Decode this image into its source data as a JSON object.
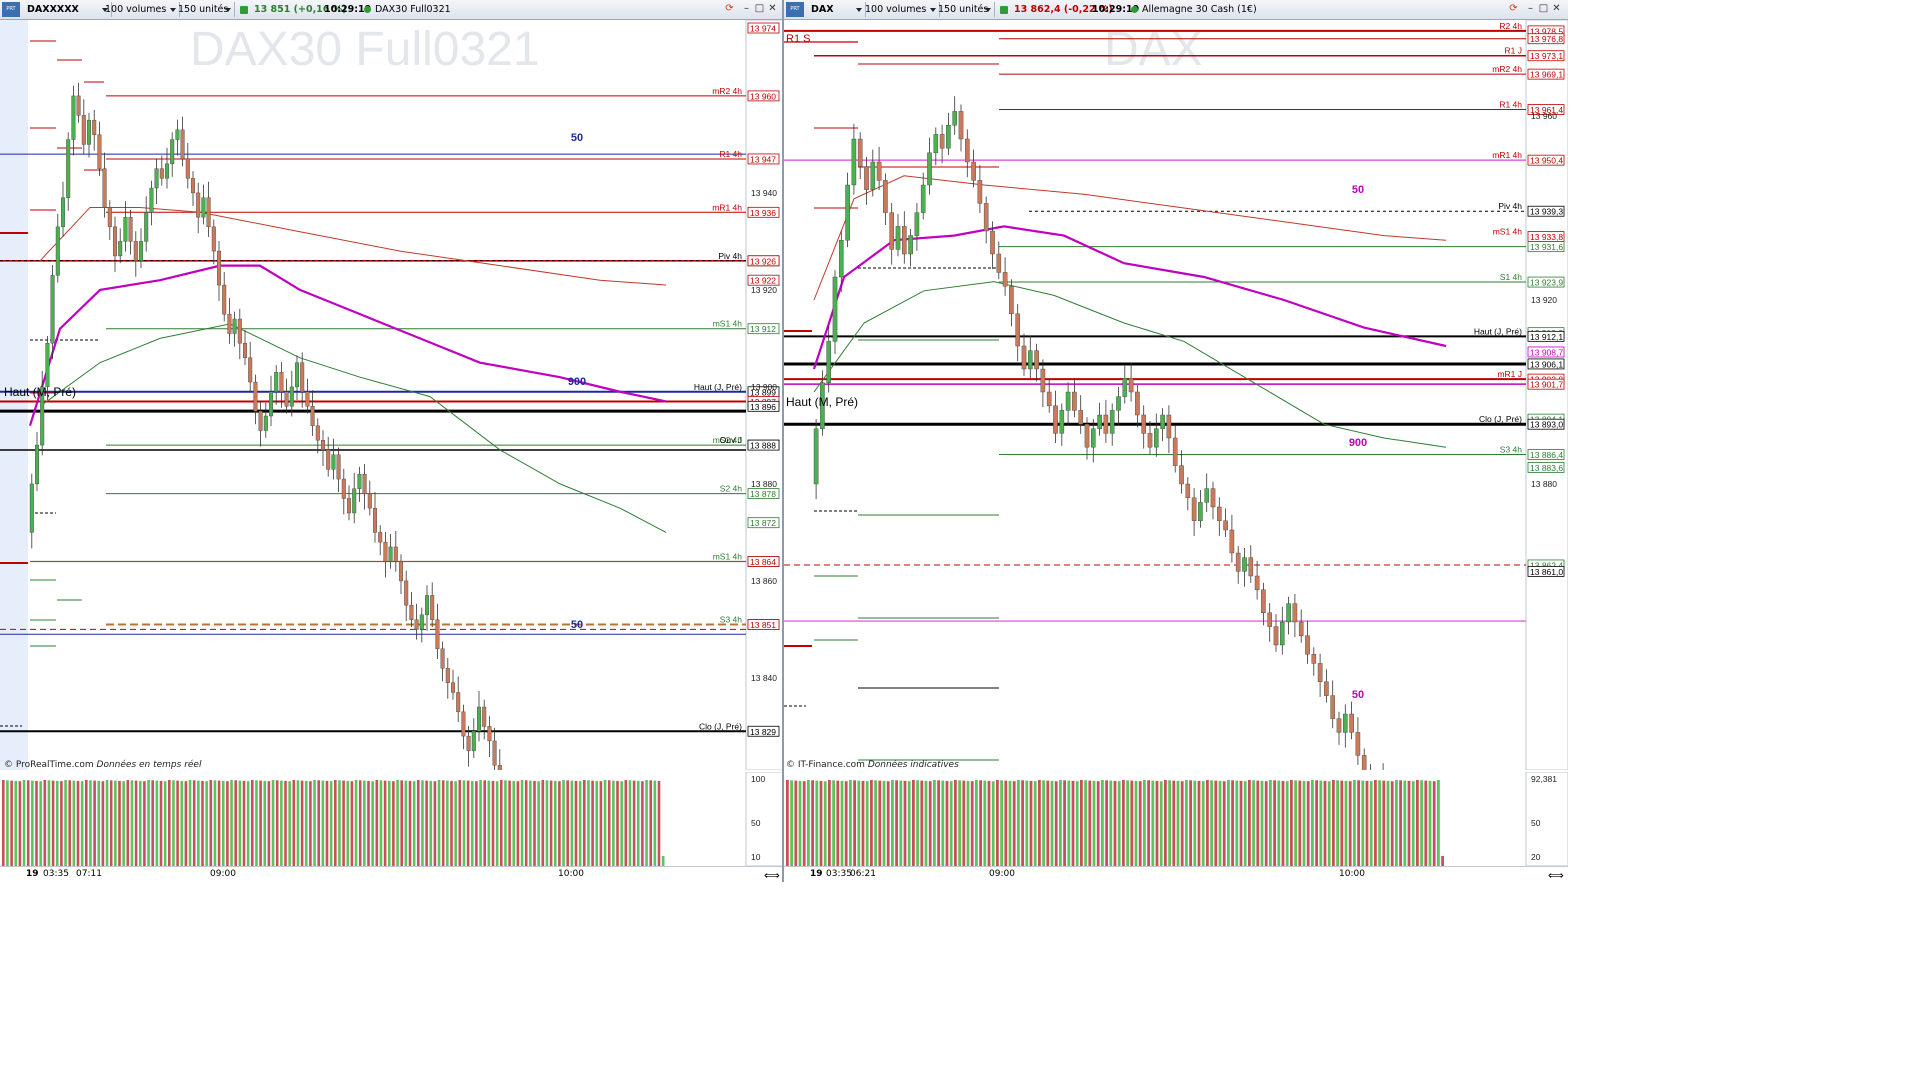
{
  "left": {
    "toolbar": {
      "instrument": "DAXXXXX",
      "volume_mode": "100 volumes",
      "units": "150 unités",
      "price": "13 851 (+0,16 %)",
      "time": "10:29:19",
      "market_name": "DAX30 Full0321"
    },
    "watermark": "DAX30 Full0321",
    "credit_source": "© ProRealTime.com",
    "credit_note": "Données en temps réel",
    "price_axis": [
      "13 940",
      "13 920",
      "13 900",
      "13 880",
      "13 860",
      "13 840"
    ],
    "level_boxes": [
      {
        "label": "",
        "value": "13 974",
        "color": "#c00000"
      },
      {
        "label": "mR2 4h",
        "value": "13 960",
        "color": "#c00000"
      },
      {
        "label": "R1 4h",
        "value": "13 947",
        "color": "#c00000"
      },
      {
        "label": "mR1 4h",
        "value": "13 936",
        "color": "#c00000"
      },
      {
        "label": "Piv 4h",
        "value": "13 926",
        "color": "#000000"
      },
      {
        "label": "",
        "value": "13 926",
        "color": "#c00000"
      },
      {
        "label": "",
        "value": "13 922",
        "color": "#c00000"
      },
      {
        "label": "mS1 4h",
        "value": "13 912",
        "color": "#2e7d32"
      },
      {
        "label": "Haut (J, Pré)",
        "value": "13 899",
        "color": "#000000"
      },
      {
        "label": "",
        "value": "13 897",
        "color": "#c00000"
      },
      {
        "label": "",
        "value": "13 896",
        "color": "#000000"
      },
      {
        "label": "mS2 4h",
        "value": "13 888",
        "color": "#2e7d32"
      },
      {
        "label": "Ouv J",
        "value": "13 888",
        "color": "#000000"
      },
      {
        "label": "S2 4h",
        "value": "13 878",
        "color": "#2e7d32"
      },
      {
        "label": "",
        "value": "13 872",
        "color": "#2e7d32"
      },
      {
        "label": "mS1 4h",
        "value": "13 864",
        "color": "#2e7d32"
      },
      {
        "label": "",
        "value": "13 864",
        "color": "#c00000"
      },
      {
        "label": "S3 4h",
        "value": "13 851",
        "color": "#2e7d32"
      },
      {
        "label": "",
        "value": "13 851",
        "color": "#c00000"
      },
      {
        "label": "Clo (J, Pré)",
        "value": "13 829",
        "color": "#000000"
      }
    ],
    "marks": {
      "fifty": "50",
      "nine_hundred": "900",
      "haut_m_pre": "Haut (M, Pré)"
    },
    "volume_axis": [
      "100",
      "50",
      "10"
    ],
    "time_labels": [
      "19",
      "03:35",
      "07:11",
      "09:00",
      "10:00"
    ]
  },
  "right": {
    "toolbar": {
      "instrument": "DAX",
      "volume_mode": "100 volumes",
      "units": "150 unités",
      "price": "13 862,4 (-0,22 %)",
      "time": "10:29:19",
      "market_name": "Allemagne 30 Cash (1€)"
    },
    "watermark": "DAX",
    "credit_source": "© IT-Finance.com",
    "credit_note": "Données indicatives",
    "price_axis": [
      "13 960",
      "13 920",
      "13 880"
    ],
    "level_boxes": [
      {
        "label": "R2 4h",
        "value": "13 978,5",
        "color": "#c00000"
      },
      {
        "label": "",
        "value": "13 976,8",
        "color": "#c00000"
      },
      {
        "label": "R1 J",
        "value": "13 973,1",
        "color": "#c00000"
      },
      {
        "label": "mR2 4h",
        "value": "13 969,1",
        "color": "#c00000"
      },
      {
        "label": "R1 4h",
        "value": "13 961,4",
        "color": "#c00000"
      },
      {
        "label": "mR1 4h",
        "value": "13 950,4",
        "color": "#c00000"
      },
      {
        "label": "Piv 4h",
        "value": "13 939,3",
        "color": "#000000"
      },
      {
        "label": "mS1 4h",
        "value": "13 933,8",
        "color": "#c00000"
      },
      {
        "label": "",
        "value": "13 931,6",
        "color": "#2e7d32"
      },
      {
        "label": "S1 4h",
        "value": "13 923,9",
        "color": "#2e7d32"
      },
      {
        "label": "",
        "value": "13 912,9",
        "color": "#2e7d32"
      },
      {
        "label": "Haut (J, Pré)",
        "value": "13 912,1",
        "color": "#000000"
      },
      {
        "label": "",
        "value": "13 908,7",
        "color": "#c000c0"
      },
      {
        "label": "",
        "value": "13 906,1",
        "color": "#000000"
      },
      {
        "label": "mR1 J",
        "value": "13 902,8",
        "color": "#c00000"
      },
      {
        "label": "",
        "value": "13 901,7",
        "color": "#c00000"
      },
      {
        "label": "",
        "value": "13 894,1",
        "color": "#2e7d32"
      },
      {
        "label": "Clo (J, Pré)",
        "value": "13 893,0",
        "color": "#000000"
      },
      {
        "label": "S3 4h",
        "value": "13 886,4",
        "color": "#2e7d32"
      },
      {
        "label": "",
        "value": "13 883,6",
        "color": "#2e7d32"
      },
      {
        "label": "",
        "value": "13 862,4",
        "color": "#2e7d32"
      },
      {
        "label": "",
        "value": "13 861,0",
        "color": "#000000"
      }
    ],
    "marks": {
      "fifty": "50",
      "nine_hundred": "900",
      "haut_m_pre": "Haut (M, Pré)",
      "r1_s": "R1 S"
    },
    "volume_axis": [
      "92,381",
      "50",
      "20"
    ],
    "time_labels": [
      "19",
      "03:35",
      "06:21",
      "09:00",
      "10:00"
    ]
  },
  "colors": {
    "up": "#4caf50",
    "down": "#c97a5a",
    "support": "#2e7d32",
    "resistance": "#c00000",
    "ma_magenta": "#c000c0"
  }
}
